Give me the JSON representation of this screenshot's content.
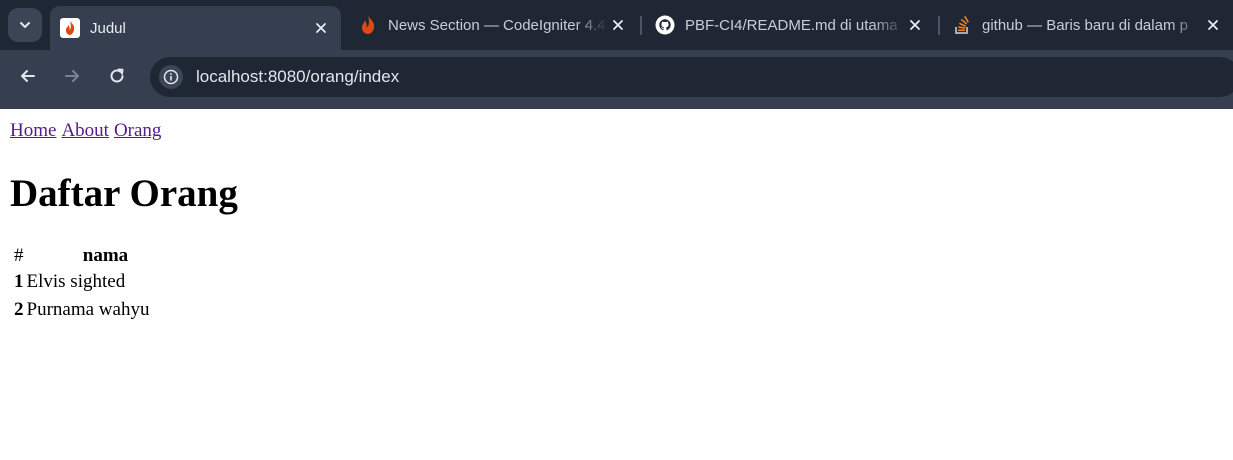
{
  "browser": {
    "tabs": [
      {
        "title": "Judul",
        "favicon": "codeigniter-flame-icon",
        "active": true
      },
      {
        "title": "News Section — CodeIgniter 4.4",
        "favicon": "codeigniter-flame-icon",
        "active": false
      },
      {
        "title": "PBF-CI4/README.md di utama",
        "favicon": "github-icon",
        "active": false
      },
      {
        "title": "github — Baris baru di dalam p",
        "favicon": "stackoverflow-icon",
        "active": false
      }
    ],
    "url": "localhost:8080/orang/index",
    "colors": {
      "tabstrip": "#1f2634",
      "toolbar": "#363f4f",
      "omnibox": "#1f2634",
      "accent_flame": "#dd4814"
    }
  },
  "page": {
    "nav": [
      {
        "label": "Home"
      },
      {
        "label": "About"
      },
      {
        "label": "Orang"
      }
    ],
    "heading": "Daftar Orang",
    "table": {
      "headers": [
        "#",
        "nama"
      ],
      "rows": [
        {
          "num": "1",
          "nama": "Elvis sighted"
        },
        {
          "num": "2",
          "nama": "Purnama wahyu"
        }
      ]
    },
    "link_color": "#551a8b"
  }
}
